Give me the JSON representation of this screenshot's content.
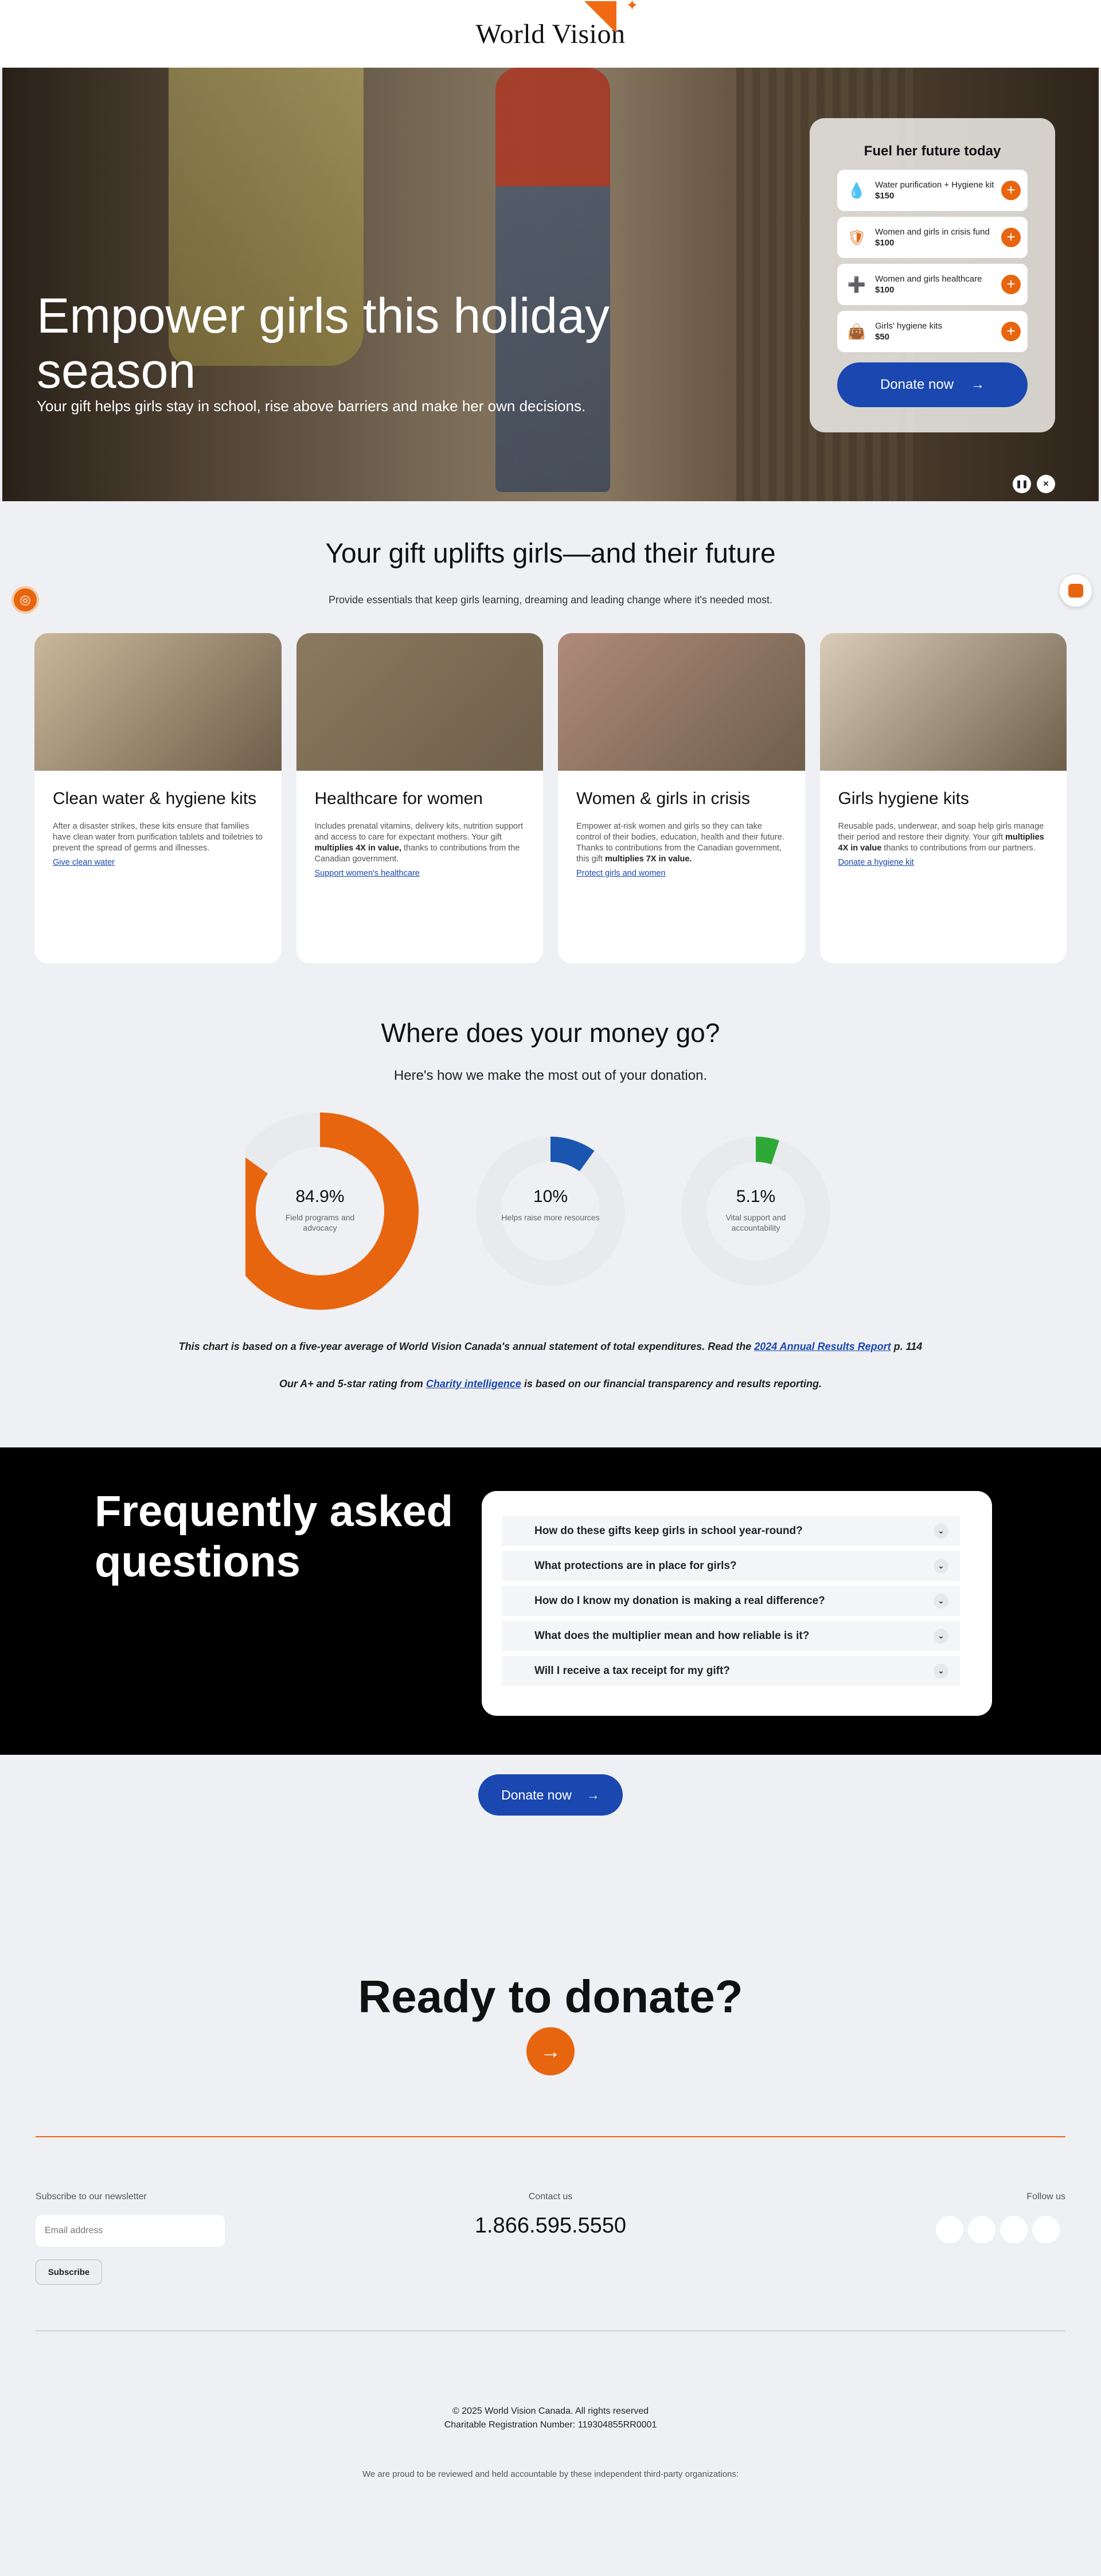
{
  "header": {
    "logo_text": "World Vision"
  },
  "hero": {
    "title": "Empower girls this holiday season",
    "subtitle": "Your gift helps girls stay in school, rise above barriers and make her own decisions.",
    "card_title": "Fuel her future today",
    "gifts": [
      {
        "icon": "water-drop-icon",
        "glyph": "💧",
        "label": "Water purification + Hygiene kit",
        "price": "$150"
      },
      {
        "icon": "shield-heart-icon",
        "glyph": "🛡",
        "label": "Women and girls in crisis fund",
        "price": "$100"
      },
      {
        "icon": "medical-kit-icon",
        "glyph": "➕",
        "label": "Women and girls healthcare",
        "price": "$100"
      },
      {
        "icon": "hygiene-bag-icon",
        "glyph": "👜",
        "label": "Girls' hygiene kits",
        "price": "$50"
      }
    ],
    "donate_label": "Donate now",
    "add_glyph": "+",
    "arrow_glyph": "→",
    "pause_glyph": "❚❚",
    "mute_glyph": "✕"
  },
  "gifts_section": {
    "title": "Your gift uplifts girls—and their future",
    "subtitle": "Provide essentials that keep girls learning, dreaming and leading change where it's needed most.",
    "cards": [
      {
        "title": "Clean water & hygiene kits",
        "text": "After a disaster strikes, these kits ensure that families have clean water from purification tablets and toiletries to prevent the spread of germs and illnesses.",
        "bold": "",
        "text_after": "",
        "link": "Give clean water",
        "image_color": "#c9b89a"
      },
      {
        "title": "Healthcare for women",
        "text": "Includes prenatal vitamins, delivery kits, nutrition support and access to care for expectant mothers. Your gift ",
        "bold": "multiplies 4X in value,",
        "text_after": " thanks to contributions from the Canadian government.",
        "link": "Support women's healthcare",
        "image_color": "#8a7a60"
      },
      {
        "title": "Women & girls in crisis",
        "text": "Empower at-risk women and girls so they can take control of their bodies, education, health and their future. Thanks to contributions from the Canadian government, this gift ",
        "bold": "multiplies 7X in value.",
        "text_after": "",
        "link": "Protect girls and women",
        "image_color": "#b08a7a"
      },
      {
        "title": "Girls hygiene kits",
        "text": "Reusable pads, underwear, and soap help girls manage their period and restore their dignity. Your gift ",
        "bold": "multiplies 4X in value",
        "text_after": " thanks to contributions from our partners.",
        "link": "Donate a hygiene kit",
        "image_color": "#d9cdb8"
      }
    ]
  },
  "money_section": {
    "title": "Where does your money go?",
    "subtitle": "Here's how we make the most out of your donation.",
    "note": "This chart is based on a five-year average of World Vision Canada's annual statement of total expenditures. Read the ",
    "note_link": "2024 Annual Results Report",
    "note_after": " p. 114",
    "rating": "Our A+ and 5-star rating from ",
    "rating_link": "Charity intelligence",
    "rating_after": " is based on our financial transparency and results reporting."
  },
  "chart_data": {
    "type": "pie",
    "title": "",
    "series": [
      {
        "label": "84.9%",
        "value": 84.9,
        "description": "Field programs and advocacy",
        "color": "#e8650f"
      },
      {
        "label": "10%",
        "value": 10,
        "description": "Helps raise more resources",
        "color": "#1a56b0"
      },
      {
        "label": "5.1%",
        "value": 5.1,
        "description": "Vital support and accountability",
        "color": "#2ea836"
      }
    ],
    "track_color": "#e8eaee"
  },
  "faq": {
    "title": "Frequently asked questions",
    "items": [
      "How do these gifts keep girls in school year-round?",
      "What protections are in place for girls?",
      "How do I know my donation is making a real difference?",
      "What does the multiplier mean and how reliable is it?",
      "Will I receive a tax receipt for my gift?"
    ],
    "chevron_glyph": "⌄",
    "donate_label": "Donate now"
  },
  "footer": {
    "ready_title": "Ready to donate?",
    "newsletter_label": "Subscribe to our newsletter",
    "email_placeholder": "Email address",
    "subscribe_label": "Subscribe",
    "contact_label": "Contact us",
    "phone": "1.866.595.5550",
    "follow_label": "Follow us",
    "copyright": "© 2025 World Vision Canada. All rights reserved",
    "registration": "Charitable Registration Number: 119304855RR0001",
    "proud_text": "We are proud to be reviewed and held accountable by these independent third-party organizations:"
  },
  "colors": {
    "accent": "#e8650f",
    "brand_blue": "#1a47b0",
    "faq_bg": "#000000"
  }
}
